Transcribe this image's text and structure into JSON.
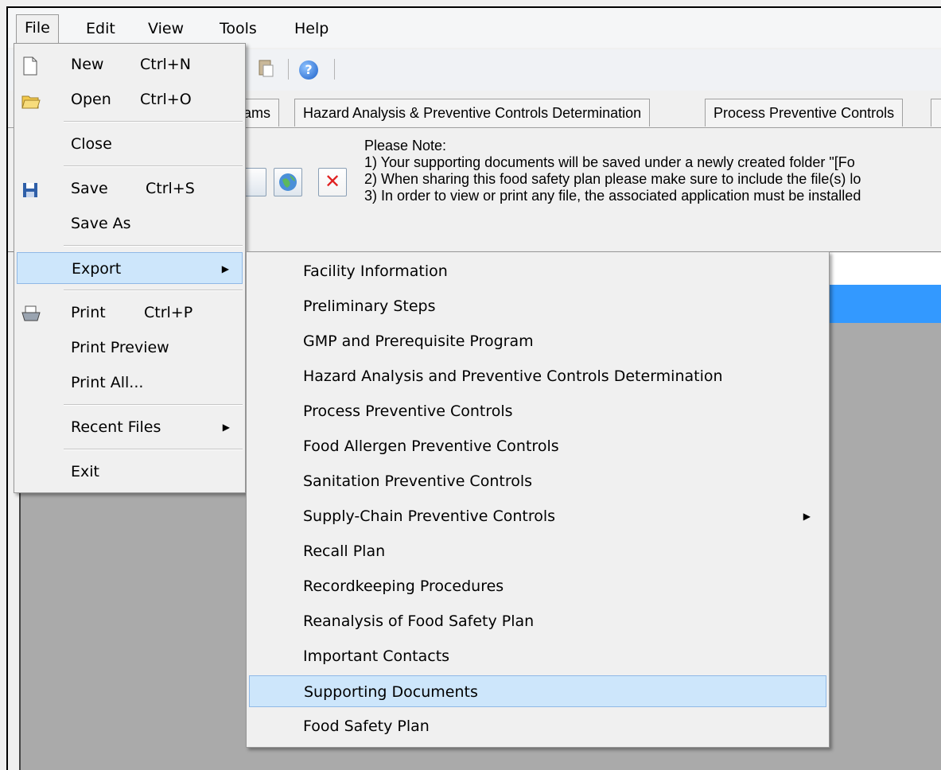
{
  "menubar": {
    "file": "File",
    "edit": "Edit",
    "view": "View",
    "tools": "Tools",
    "help": "Help"
  },
  "tabs": {
    "partial": "rams",
    "hazard": "Hazard Analysis & Preventive Controls Determination",
    "process": "Process Preventive Controls"
  },
  "note": {
    "title": "Please Note:",
    "line1": "1) Your supporting documents will be saved under a newly created folder \"[Fo",
    "line2": "2) When sharing this food safety plan please make sure to include the file(s) lo",
    "line3": "3) In order to view or print any file, the associated application must be installed"
  },
  "file_menu": {
    "new": {
      "label": "New",
      "shortcut": "Ctrl+N"
    },
    "open": {
      "label": "Open",
      "shortcut": "Ctrl+O"
    },
    "close": {
      "label": "Close"
    },
    "save": {
      "label": "Save",
      "shortcut": "Ctrl+S"
    },
    "save_as": {
      "label": "Save As"
    },
    "export": {
      "label": "Export"
    },
    "print": {
      "label": "Print",
      "shortcut": "Ctrl+P"
    },
    "print_preview": {
      "label": "Print Preview"
    },
    "print_all": {
      "label": "Print All..."
    },
    "recent_files": {
      "label": "Recent Files"
    },
    "exit": {
      "label": "Exit"
    }
  },
  "export_menu": [
    "Facility Information",
    "Preliminary Steps",
    "GMP and Prerequisite Program",
    "Hazard Analysis and Preventive Controls Determination",
    "Process Preventive Controls",
    "Food Allergen Preventive Controls",
    "Sanitation Preventive Controls",
    "Supply-Chain Preventive Controls",
    "Recall Plan",
    "Recordkeeping Procedures",
    "Reanalysis of Food Safety Plan",
    "Important Contacts",
    "Supporting Documents",
    "Food Safety Plan"
  ],
  "icons": {
    "help": "?",
    "submenu_arrow": "▶",
    "delete": "✕"
  },
  "colors": {
    "highlight": "#cde6fb",
    "highlight_border": "#8fb8e6",
    "grid_selection": "#3399ff"
  }
}
